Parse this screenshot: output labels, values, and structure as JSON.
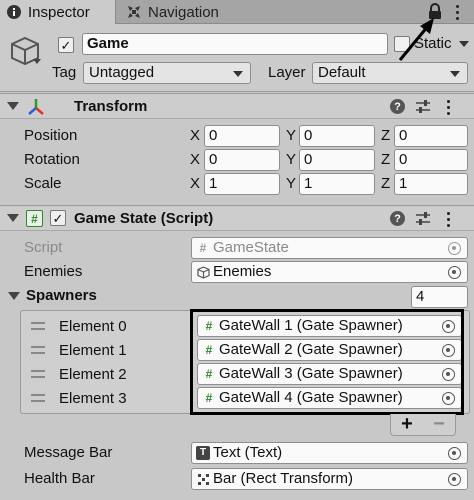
{
  "tabs": [
    {
      "label": "Inspector",
      "icon": "info-icon",
      "active": true
    },
    {
      "label": "Navigation",
      "icon": "navigation-icon",
      "active": false
    }
  ],
  "gameobject": {
    "active": true,
    "name": "Game",
    "static_label": "Static",
    "tag_label": "Tag",
    "tag_value": "Untagged",
    "layer_label": "Layer",
    "layer_value": "Default"
  },
  "transform": {
    "title": "Transform",
    "rows": [
      {
        "label": "Position",
        "x": "0",
        "y": "0",
        "z": "0"
      },
      {
        "label": "Rotation",
        "x": "0",
        "y": "0",
        "z": "0"
      },
      {
        "label": "Scale",
        "x": "1",
        "y": "1",
        "z": "1"
      }
    ],
    "axes": {
      "x": "X",
      "y": "Y",
      "z": "Z"
    }
  },
  "script_component": {
    "title": "Game State (Script)",
    "enabled": true,
    "script_label": "Script",
    "script_value": "GameState",
    "enemies_label": "Enemies",
    "enemies_value": "Enemies",
    "spawners_label": "Spawners",
    "spawners_size": "4",
    "elements": [
      {
        "label": "Element 0",
        "value": "GateWall 1 (Gate Spawner)"
      },
      {
        "label": "Element 1",
        "value": "GateWall 2 (Gate Spawner)"
      },
      {
        "label": "Element 2",
        "value": "GateWall 3 (Gate Spawner)"
      },
      {
        "label": "Element 3",
        "value": "GateWall 4 (Gate Spawner)"
      }
    ],
    "add_label": "+",
    "remove_label": "−",
    "message_bar_label": "Message Bar",
    "message_bar_value": "Text (Text)",
    "health_bar_label": "Health Bar",
    "health_bar_value": "Bar (Rect Transform)"
  },
  "hash_glyph": "#",
  "help_glyph": "?",
  "text_icon_glyph": "T",
  "check_glyph": "✓"
}
